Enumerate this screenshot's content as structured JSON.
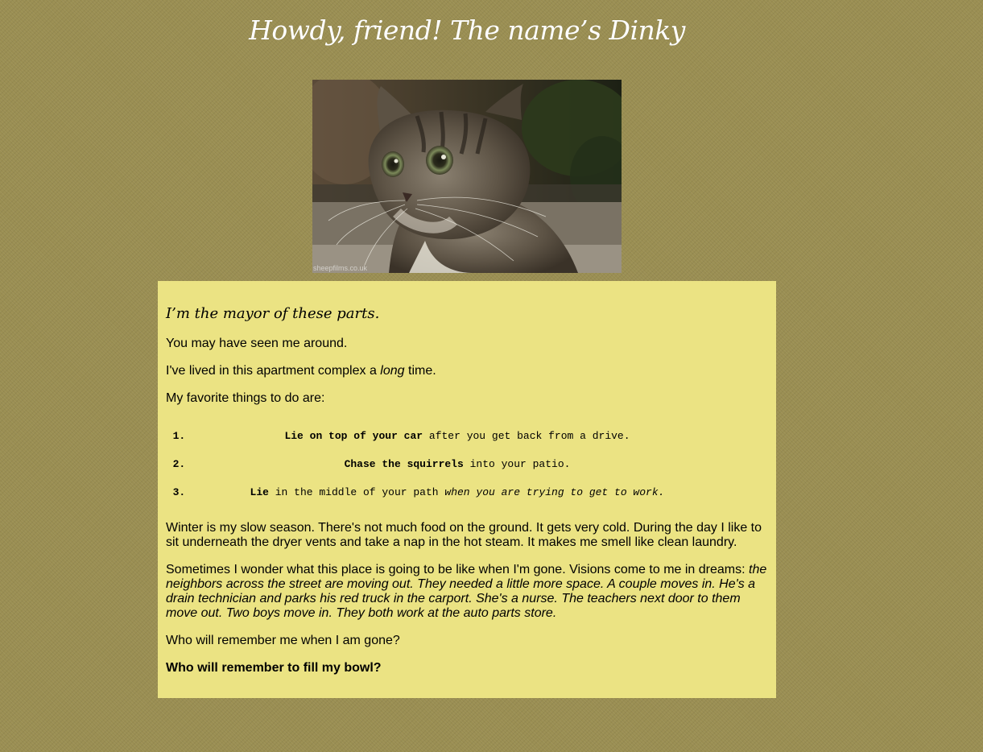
{
  "header": {
    "title": "Howdy, friend! The name’s Dinky"
  },
  "photo": {
    "watermark": "sheepfilms.co.uk"
  },
  "card": {
    "tagline": "I’m the mayor of these parts.",
    "p1": "You may have seen me around.",
    "p2_before": "I've lived in this apartment complex a ",
    "p2_em": "long",
    "p2_after": " time.",
    "p3": "My favorite things to do are:",
    "favorites": [
      {
        "bold": "Lie on top of your car",
        "rest": " after you get back from a drive.",
        "italic": ""
      },
      {
        "bold": "Chase the squirrels",
        "rest": " into your patio.",
        "italic": ""
      },
      {
        "bold": "Lie",
        "rest": " in the middle of your path ",
        "italic": "when you are trying to get to work."
      }
    ],
    "p4": "Winter is my slow season. There's not much food on the ground. It gets very cold. During the day I like to sit underneath the dryer vents and take a nap in the hot steam. It makes me smell like clean laundry.",
    "p5_plain": "Sometimes I wonder what this place is going to be like when I'm gone. Visions come to me in dreams: ",
    "p5_italic": "the neighbors across the street are moving out. They needed a little more space. A couple moves in. He's a drain technician and parks his red truck in the carport. She's a nurse. The teachers next door to them move out. Two boys move in. They both work at the auto parts store.",
    "p6": "Who will remember me when I am gone?",
    "p7": "Who will remember to fill my bowl?"
  }
}
